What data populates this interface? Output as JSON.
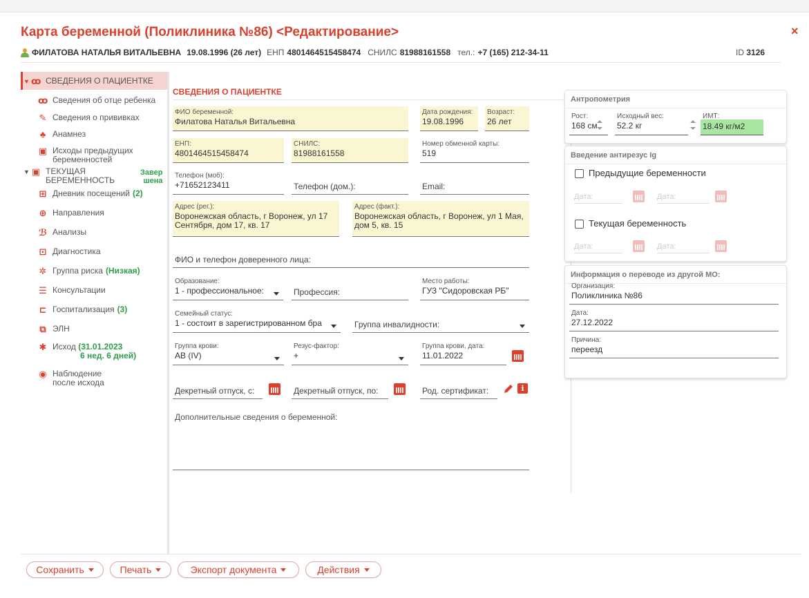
{
  "header": {
    "title": "Карта беременной (Поликлиника №86) <Редактирование>",
    "close": "×",
    "patient_name": "ФИЛАТОВА НАТАЛЬЯ ВИТАЛЬЕВНА",
    "birth": "19.08.1996 (26 лет)",
    "enp_label": "ЕНП",
    "enp": "4801464515458474",
    "snils_label": "СНИЛС",
    "snils": "81988161558",
    "phone_label": "тел.:",
    "phone": "+7 (165) 212-34-11",
    "id_label": "ID",
    "id": "3126"
  },
  "sidebar": {
    "items": [
      {
        "label": "СВЕДЕНИЯ О ПАЦИЕНТКЕ",
        "icon": "pregnant-icon"
      },
      {
        "label": "Сведения об отце ребенка",
        "icon": "pregnant-icon"
      },
      {
        "label": "Сведения о прививках",
        "icon": "syringe-icon"
      },
      {
        "label": "Анамнез",
        "icon": "family-icon"
      },
      {
        "label": "Исходы предыдущих",
        "label2": "беременностей",
        "icon": "clipboard-icon"
      },
      {
        "label": "ТЕКУЩАЯ",
        "label2": "БЕРЕМЕННОСТЬ",
        "status1": "Завер",
        "status2": "шена",
        "icon": "clipboard-icon"
      },
      {
        "label": "Дневник посещений",
        "count": "(2)",
        "icon": "table-icon"
      },
      {
        "label": "Направления",
        "icon": "plus-calendar-icon"
      },
      {
        "label": "Анализы",
        "icon": "microscope-icon"
      },
      {
        "label": "Диагностика",
        "icon": "diagnostics-icon"
      },
      {
        "label": "Группа риска",
        "extra": "(Низкая)",
        "icon": "biohazard-icon"
      },
      {
        "label": "Консультации",
        "icon": "document-icon"
      },
      {
        "label": "Госпитализация",
        "count": "(3)",
        "icon": "bed-icon"
      },
      {
        "label": "ЭЛН",
        "icon": "copy-icon"
      },
      {
        "label": "Исход",
        "extra": "(31.01.2023",
        "extra2": "6 нед. 6 дней)",
        "icon": "baby-icon"
      },
      {
        "label": "Наблюдение",
        "label2": "после исхода",
        "icon": "eye-icon"
      }
    ]
  },
  "main": {
    "section_title": "СВЕДЕНИЯ О ПАЦИЕНТКЕ",
    "fio_label": "ФИО беременной:",
    "fio": "Филатова Наталья Витальевна",
    "dob_label": "Дата рождения:",
    "dob": "19.08.1996",
    "age_label": "Возраст:",
    "age": "26 лет",
    "enp_label": "ЕНП:",
    "enp": "4801464515458474",
    "snils_label": "СНИЛС:",
    "snils": "81988161558",
    "exchange_label": "Номер обменной карты:",
    "exchange": "519",
    "mobile_label": "Телефон (моб):",
    "mobile": "+71652123411",
    "home_phone_label": "Телефон (дом.):",
    "email_label": "Email:",
    "addr_reg_label": "Адрес (рег.):",
    "addr_reg": "Воронежская область, г Воронеж, ул 17 Сентября, дом 17, кв. 17",
    "addr_fact_label": "Адрес (факт.):",
    "addr_fact": "Воронежская область, г Воронеж, ул 1 Мая, дом 5, кв. 15",
    "trusted_label": "ФИО и телефон доверенного лица:",
    "education_label": "Образование:",
    "education": "1 - профессиональное:",
    "profession_label": "Профессия:",
    "work_label": "Место работы:",
    "work": "ГУЗ \"Сидоровская РБ\"",
    "family_label": "Семейный статус:",
    "family": "1 - состоит в зарегистрированном бра",
    "disability_label": "Группа инвалидности:",
    "blood_label": "Группа крови:",
    "blood": "AB (IV)",
    "rh_label": "Резус-фактор:",
    "rh": "+",
    "blood_date_label": "Группа крови, дата:",
    "blood_date": "11.01.2022",
    "leave_from_label": "Декретный отпуск, с:",
    "leave_to_label": "Декретный отпуск, по:",
    "cert_label": "Род. сертификат:",
    "extra_label": "Дополнительные сведения о беременной:"
  },
  "anthropometry": {
    "title": "Антропометрия",
    "height_label": "Рост:",
    "height": "168 см",
    "weight_label": "Исходный вес:",
    "weight": "52.2 кг",
    "bmi_label": "ИМТ:",
    "bmi": "18.49 кг/м2",
    "bmi_color": "#a8e6a1"
  },
  "antirhesus": {
    "title": "Введение антирезус Ig",
    "prev_label": "Предыдущие беременности",
    "current_label": "Текущая беременность",
    "date_placeholder": "Дата:"
  },
  "transfer": {
    "title": "Информация о переводе из другой МО:",
    "org_label": "Организация:",
    "org": "Поликлиника №86",
    "date_label": "Дата:",
    "date": "27.12.2022",
    "reason_label": "Причина:",
    "reason": "переезд"
  },
  "footer": {
    "save": "Сохранить",
    "print": "Печать",
    "export": "Экспорт документа",
    "actions": "Действия"
  },
  "colors": {
    "accent": "#d9412e",
    "field_highlight": "#fbf6d2",
    "status_green": "#2e9e4a"
  }
}
